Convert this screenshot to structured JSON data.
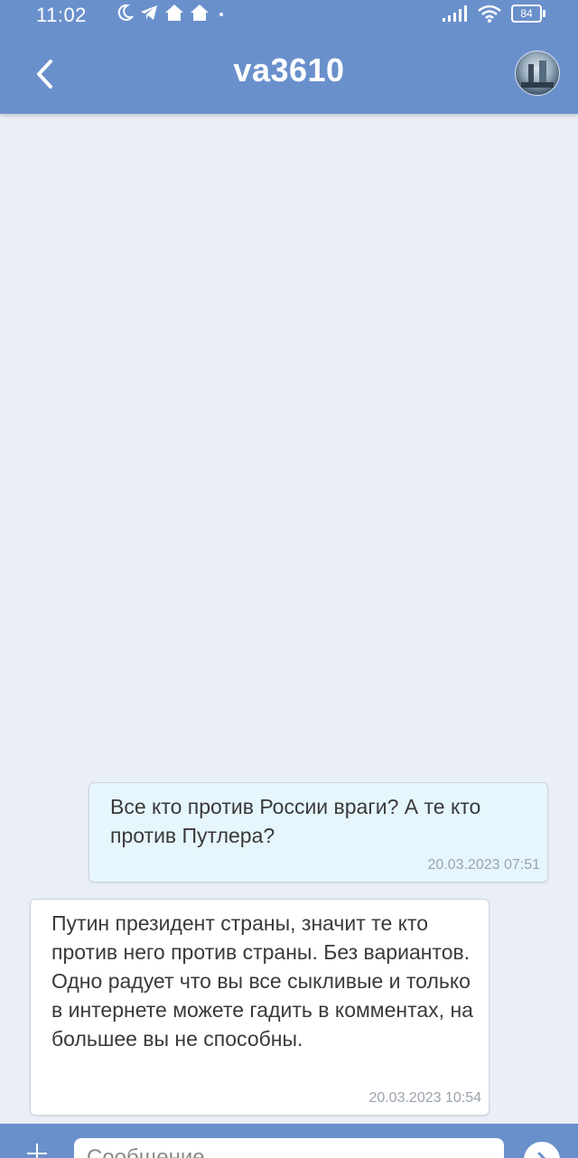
{
  "status_bar": {
    "time": "11:02",
    "battery": "84",
    "icons": [
      "moon-icon",
      "telegram-icon",
      "home-icon",
      "home-icon",
      "dot-icon",
      "signal-icon",
      "wifi-icon",
      "battery-icon"
    ]
  },
  "app_bar": {
    "title": "va3610",
    "back_icon": "chevron-left-icon",
    "avatar": "user-avatar"
  },
  "messages": [
    {
      "direction": "outgoing",
      "text": "Все кто против России враги? А те кто против Путлера?",
      "time": "20.03.2023 07:51"
    },
    {
      "direction": "incoming",
      "text": "Путин президент страны, значит те кто против него против страны. Без вариантов. Одно радует что вы все сыкливые и только в интернете можете гадить в комментах, на большее вы не способны.",
      "time": "20.03.2023 10:54"
    }
  ],
  "input": {
    "placeholder": "Сообщение",
    "value": ""
  },
  "colors": {
    "header": "#6a90cc",
    "background": "#e9eef7",
    "outgoing_bubble": "#e6f6fd",
    "incoming_bubble": "#ffffff"
  }
}
